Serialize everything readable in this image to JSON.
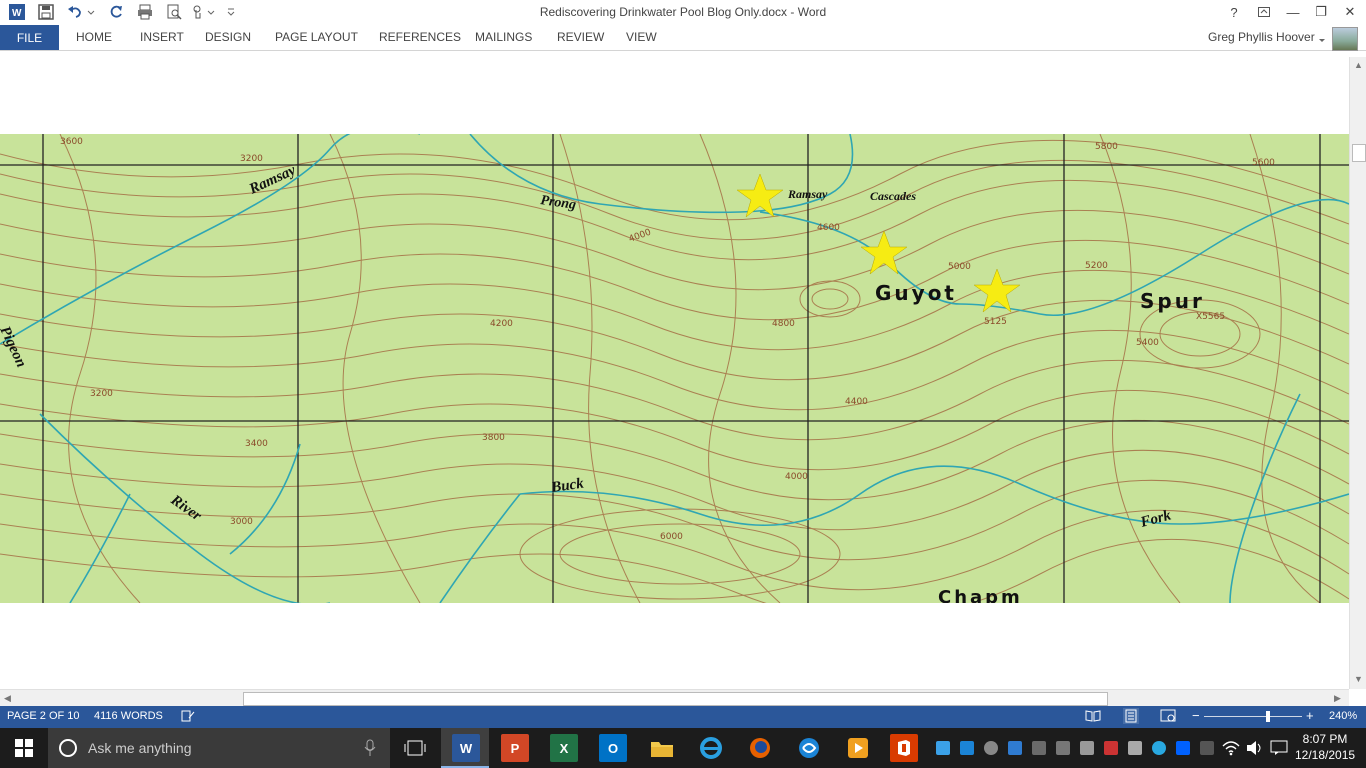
{
  "window": {
    "title": "Rediscovering Drinkwater Pool Blog Only.docx - Word",
    "help": "?",
    "minimize": "—",
    "restore": "❐",
    "close": "✕"
  },
  "ribbon": {
    "file_label": "FILE",
    "tabs": [
      "HOME",
      "INSERT",
      "DESIGN",
      "PAGE LAYOUT",
      "REFERENCES",
      "MAILINGS",
      "REVIEW",
      "VIEW"
    ],
    "user_name": "Greg Phyllis Hoover"
  },
  "map": {
    "labels": {
      "ramsay_left": "Ramsay",
      "prong": "Prong",
      "ramsay_right": "Ramsay",
      "cascades": "Cascades",
      "guyot": "Guyot",
      "spur": "Spur",
      "pigeon": "Pigeon",
      "river": "River",
      "buck": "Buck",
      "fork": "Fork",
      "chapman": "Chapm"
    },
    "elevations": {
      "e1": "3600",
      "e2": "3200",
      "e3": "4000",
      "e4": "4600",
      "e5": "5000",
      "e6": "5125",
      "e7": "5200",
      "e8": "5400",
      "e9": "X5565",
      "e10": "4800",
      "e11": "4200",
      "e12": "3800",
      "e13": "3400",
      "e14": "4400",
      "e15": "4000",
      "e16": "5600",
      "e17": "6000",
      "e18": "3200",
      "e19": "3000",
      "e20": "5800"
    },
    "star_color": "#f6ec13",
    "land_color": "#c8e39a",
    "contour_color": "#a0603a",
    "stream_color": "#2fa6b3"
  },
  "status": {
    "page": "PAGE 2 OF 10",
    "words": "4116 WORDS",
    "zoom": "240%",
    "minus": "−",
    "plus": "+"
  },
  "taskbar": {
    "search_placeholder": "Ask me anything",
    "apps": {
      "word": "W",
      "powerpoint": "P",
      "excel": "X",
      "outlook": "O"
    },
    "time": "8:07 PM",
    "date": "12/18/2015"
  }
}
